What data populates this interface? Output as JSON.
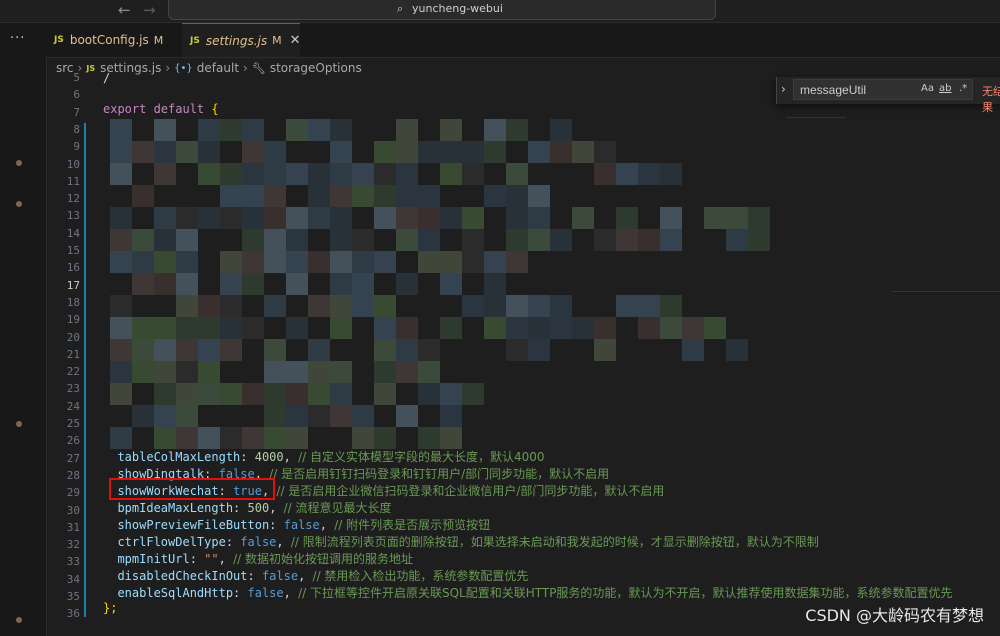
{
  "titlebar": {
    "back_arrow": "←",
    "forward_arrow": "→",
    "search_text": "yuncheng-webui",
    "search_icon": "search-icon"
  },
  "activity": {
    "more_label": "···"
  },
  "tabs": [
    {
      "label": "bootConfig.js",
      "badge": "M",
      "icon": "JS"
    },
    {
      "label": "settings.js",
      "badge": "M",
      "icon": "JS",
      "close": "✕"
    }
  ],
  "breadcrumb": {
    "items": [
      "src",
      "settings.js",
      "default",
      "storageOptions"
    ]
  },
  "find_widget": {
    "value": "messageUtil",
    "match_case": "Aa",
    "whole_word": "ab",
    "regex": ".*",
    "result": "无结果"
  },
  "editor": {
    "line_numbers": [
      "5",
      "6",
      "7",
      "8",
      "9",
      "10",
      "11",
      "12",
      "13",
      "14",
      "15",
      "16",
      "17",
      "18",
      "19",
      "20",
      "21",
      "22",
      "23",
      "24",
      "25",
      "26",
      "27",
      "28",
      "29",
      "30",
      "31",
      "32",
      "33",
      "34",
      "35",
      "36"
    ],
    "line5": "/",
    "line6_kw": "export default",
    "line6_brace": "{",
    "line26": {
      "prop": "tableColMaxLength",
      "val": "4000",
      "comment": "// 自定义实体模型字段的最大长度，默认4000"
    },
    "line27": {
      "prop": "showDingtalk",
      "val": "false",
      "comment": "// 是否启用钉钉扫码登录和钉钉用户/部门同步功能，默认不启用"
    },
    "line28": {
      "prop": "showWorkWechat",
      "val": "true",
      "comment": "// 是否启用企业微信扫码登录和企业微信用户/部门同步功能，默认不启用"
    },
    "line29": {
      "prop": "bpmIdeaMaxLength",
      "val": "500",
      "comment": "// 流程意见最大长度"
    },
    "line30": {
      "prop": "showPreviewFileButton",
      "val": "false",
      "comment": "// 附件列表是否展示预览按钮"
    },
    "line31": {
      "prop": "ctrlFlowDelType",
      "val": "false",
      "comment": "// 限制流程列表页面的删除按钮，如果选择未启动和我发起的时候，才显示删除按钮，默认为不限制"
    },
    "line32": {
      "prop": "mpmInitUrl",
      "val": "\"\"",
      "comment": "// 数据初始化按钮调用的服务地址"
    },
    "line33": {
      "prop": "disabledCheckInOut",
      "val": "false",
      "comment": "// 禁用检入检出功能，系统参数配置优先"
    },
    "line34": {
      "prop": "enableSqlAndHttp",
      "val": "false",
      "comment": "// 下拉框等控件开启原关联SQL配置和关联HTTP服务的功能，默认为不开启，默认推荐使用数据集功能，系统参数配置优先"
    },
    "line35": "};"
  },
  "watermark": "CSDN @大龄码农有梦想",
  "colors": {
    "background": "#1e1e1e",
    "highlight_box": "#e01010",
    "keyword": "#c586c0",
    "property": "#9cdcfe",
    "boolean": "#569cd6",
    "number": "#b5cea8",
    "comment": "#6a9955"
  }
}
